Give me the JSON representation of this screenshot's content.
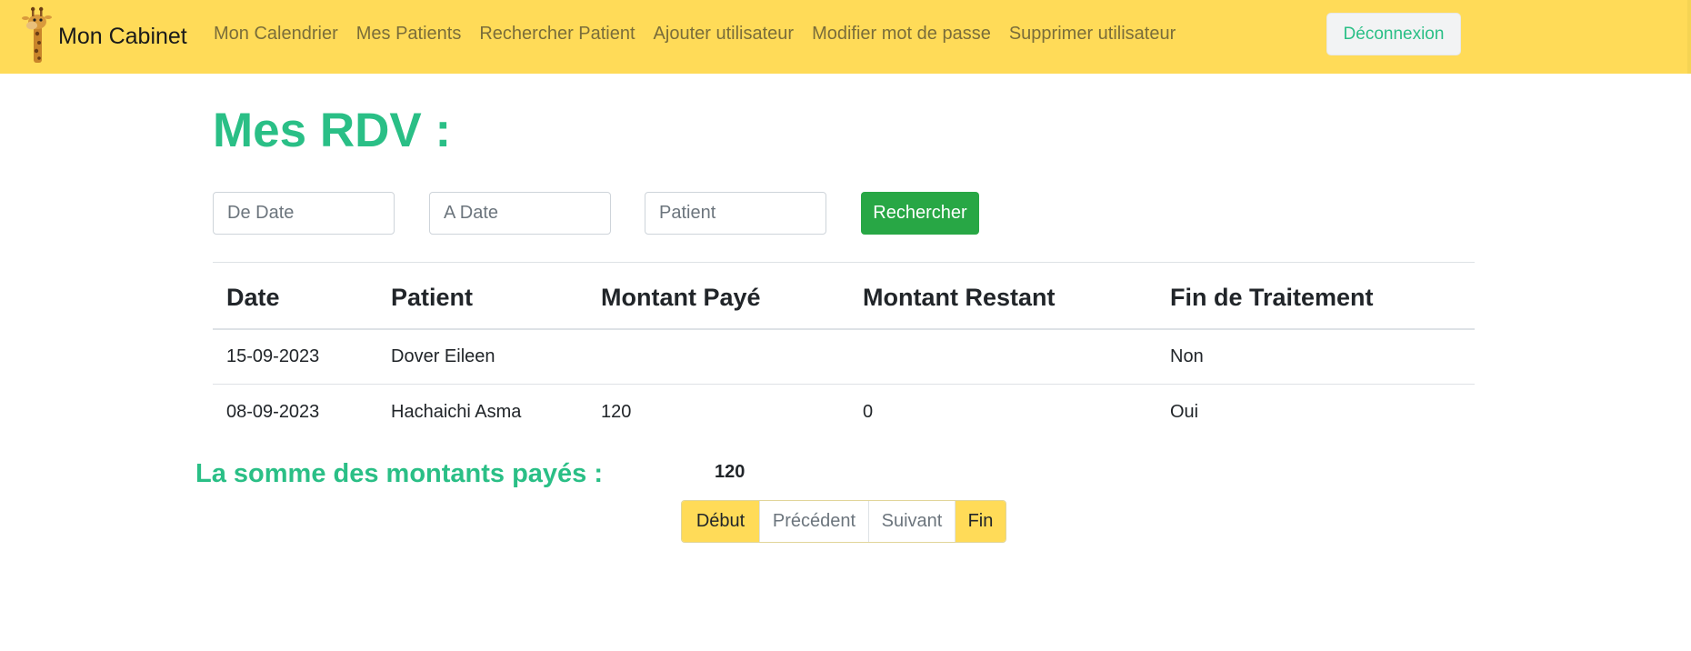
{
  "navbar": {
    "brand": "Mon Cabinet",
    "logo_icon": "giraffe-logo",
    "links": [
      "Mon Calendrier",
      "Mes Patients",
      "Rechercher Patient",
      "Ajouter utilisateur",
      "Modifier mot de passe",
      "Supprimer utilisateur"
    ],
    "logout": "Déconnexion",
    "bg_color": "#ffdb58"
  },
  "page": {
    "title": "Mes RDV :"
  },
  "search": {
    "from_placeholder": "De Date",
    "to_placeholder": "A Date",
    "patient_placeholder": "Patient",
    "button": "Rechercher"
  },
  "table": {
    "headers": [
      "Date",
      "Patient",
      "Montant Payé",
      "Montant Restant",
      "Fin de Traitement"
    ],
    "rows": [
      [
        "15-09-2023",
        "Dover Eileen",
        "",
        "",
        "Non"
      ],
      [
        "08-09-2023",
        "Hachaichi Asma",
        "120",
        "0",
        "Oui"
      ]
    ]
  },
  "summary": {
    "label": "La somme des montants payés :",
    "value": "120"
  },
  "pagination": {
    "first": "Début",
    "prev": "Précédent",
    "next": "Suivant",
    "last": "Fin"
  },
  "colors": {
    "accent": "#2abf86",
    "button_green": "#28a745"
  }
}
